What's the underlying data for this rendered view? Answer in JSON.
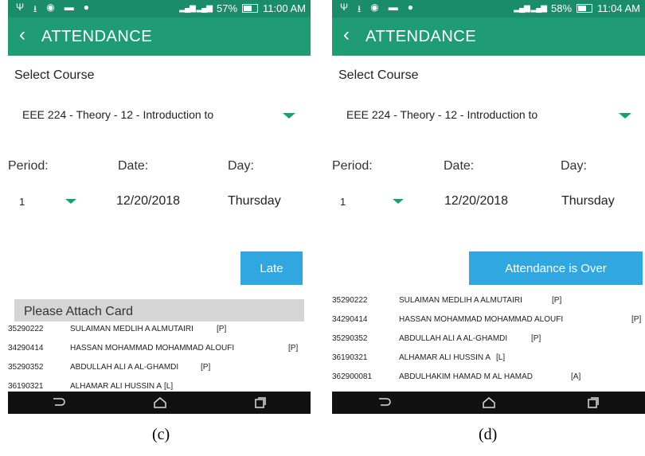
{
  "screens": [
    {
      "status": {
        "battery": "57%",
        "time": "11:00 AM"
      },
      "app_bar": {
        "title": "ATTENDANCE"
      },
      "select_course_label": "Select Course",
      "course": "EEE 224 - Theory - 12 - Introduction to",
      "labels": {
        "period": "Period:",
        "date": "Date:",
        "day": "Day:"
      },
      "values": {
        "period": "1",
        "date": "12/20/2018",
        "day": "Thursday"
      },
      "action_button": "Late",
      "card_banner": "Please Attach Card",
      "students": [
        {
          "id": "35290222",
          "name": "SULAIMAN MEDLIH A ALMUTAIRI",
          "status": "[P]"
        },
        {
          "id": "34290414",
          "name": "HASSAN MOHAMMAD MOHAMMAD ALOUFI",
          "status": "[P]"
        },
        {
          "id": "35290352",
          "name": "ABDULLAH ALI A AL-GHAMDI",
          "status": "[P]"
        },
        {
          "id": "36190321",
          "name": "ALHAMAR ALI HUSSIN A",
          "status": "[L]"
        }
      ],
      "caption": "(c)"
    },
    {
      "status": {
        "battery": "58%",
        "time": "11:04 AM"
      },
      "app_bar": {
        "title": "ATTENDANCE"
      },
      "select_course_label": "Select Course",
      "course": "EEE 224 - Theory - 12 - Introduction to",
      "labels": {
        "period": "Period:",
        "date": "Date:",
        "day": "Day:"
      },
      "values": {
        "period": "1",
        "date": "12/20/2018",
        "day": "Thursday"
      },
      "action_button": "Attendance is Over",
      "students": [
        {
          "id": "35290222",
          "name": "SULAIMAN MEDLIH A ALMUTAIRI",
          "status": "[P]"
        },
        {
          "id": "34290414",
          "name": "HASSAN MOHAMMAD MOHAMMAD ALOUFI",
          "status": "[P]"
        },
        {
          "id": "35290352",
          "name": "ABDULLAH ALI A AL-GHAMDI",
          "status": "[P]"
        },
        {
          "id": "36190321",
          "name": "ALHAMAR ALI HUSSIN A",
          "status": "[L]"
        },
        {
          "id": "362900081",
          "name": "ABDULHAKIM HAMAD M AL HAMAD",
          "status": "[A]"
        }
      ],
      "caption": "(d)"
    }
  ]
}
